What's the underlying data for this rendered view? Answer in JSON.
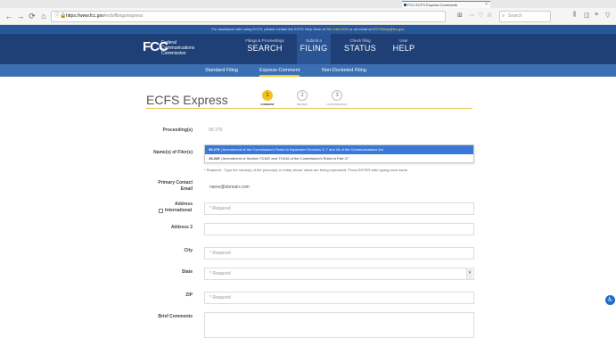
{
  "browser": {
    "tab_title": "FCC ECFS Express Comments",
    "tab_close": "×",
    "nav_icons": {
      "back": "←",
      "forward": "→",
      "reload": "⟳",
      "home": "⌂"
    },
    "url_host": "https://www.fcc.gov",
    "url_path": "/ecfs/filings/express",
    "url_right_icons": [
      "⊞",
      "⋯",
      "♡",
      "☆"
    ],
    "search_placeholder": "Search",
    "toolbar_icons": [
      "⫼",
      "◫",
      "≡",
      "▽"
    ]
  },
  "notice": {
    "text": "For assistance with using ECFS, please contact the ECFS Help Desk at ",
    "phone": "202-418-0193",
    "middle": " or via email at ",
    "email": "ECFSHelp@fcc.gov"
  },
  "header": {
    "logo": "FCC",
    "agency_line1": "Federal",
    "agency_line2": "Communications",
    "agency_line3": "Commission",
    "nav": [
      {
        "small": "Filings & Proceedings",
        "big": "SEARCH"
      },
      {
        "small": "Submit a",
        "big": "FILING"
      },
      {
        "small": "Check filing",
        "big": "STATUS"
      },
      {
        "small": "User",
        "big": "HELP"
      }
    ]
  },
  "subnav": {
    "items": [
      "Standard Filing",
      "Express Comment",
      "Non-Docketed Filing"
    ]
  },
  "page": {
    "title": "ECFS Express",
    "steps": [
      {
        "num": "1",
        "label": "COMMENT"
      },
      {
        "num": "2",
        "label": "REVIEW"
      },
      {
        "num": "3",
        "label": "CONFIRMATION"
      }
    ]
  },
  "form": {
    "proceeding_label": "Proceeding(s)",
    "proceeding_value": "95-279",
    "filer_label": "Name(s) of Filer(s)",
    "dropdown": [
      {
        "code": "95-279",
        "desc": " | Amendment of the Commission's Rules to Implement Sections 3, 7 and 18 of the Communications Act"
      },
      {
        "code": "19-226",
        "desc": " | Amendment of Section 73.622 and 73.616 of the Commission's Rules in Part 27"
      }
    ],
    "help_text": "* Required - Type the name(s) of the person(s) or entity whose views are being expressed. Press ENTER after typing each name.",
    "email_label_1": "Primary Contact",
    "email_label_2": "Email",
    "email_value": "name@domain.com",
    "address_label": "Address",
    "international_label": "International",
    "address_placeholder": "* Required",
    "address2_label": "Address 2",
    "city_label": "City",
    "city_placeholder": "* Required",
    "state_label": "State",
    "state_placeholder": "* Required",
    "state_arrow": "▾",
    "zip_label": "ZIP",
    "zip_placeholder": "* Required",
    "comments_label": "Brief Comments"
  },
  "accessibility_icon": "♿"
}
